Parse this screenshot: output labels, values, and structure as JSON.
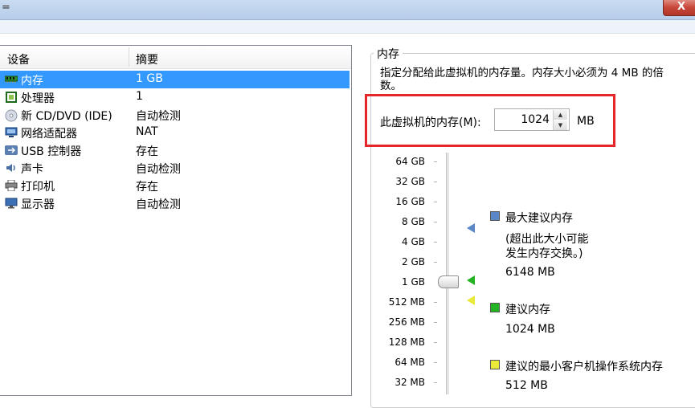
{
  "window": {
    "title_glyph": "=",
    "close_label": "X"
  },
  "device_table": {
    "headers": {
      "device": "设备",
      "summary": "摘要"
    },
    "rows": [
      {
        "name": "内存",
        "summary": "1 GB",
        "icon": "memory-icon",
        "selected": true
      },
      {
        "name": "处理器",
        "summary": "1",
        "icon": "processor-icon",
        "selected": false
      },
      {
        "name": "新 CD/DVD (IDE)",
        "summary": "自动检测",
        "icon": "cd-dvd-icon",
        "selected": false
      },
      {
        "name": "网络适配器",
        "summary": "NAT",
        "icon": "network-adapter-icon",
        "selected": false
      },
      {
        "name": "USB 控制器",
        "summary": "存在",
        "icon": "usb-icon",
        "selected": false
      },
      {
        "name": "声卡",
        "summary": "自动检测",
        "icon": "sound-card-icon",
        "selected": false
      },
      {
        "name": "打印机",
        "summary": "存在",
        "icon": "printer-icon",
        "selected": false
      },
      {
        "name": "显示器",
        "summary": "自动检测",
        "icon": "monitor-icon",
        "selected": false
      }
    ]
  },
  "memory": {
    "group_title": "内存",
    "description": "指定分配给此虚拟机的内存量。内存大小必须为 4 MB 的倍数。",
    "input_label": "此虚拟机的内存(M):",
    "value": "1024",
    "unit": "MB",
    "spin_up": "▲",
    "spin_down": "▼"
  },
  "scale": {
    "ticks": [
      "64 GB",
      "32 GB",
      "16 GB",
      "8 GB",
      "4 GB",
      "2 GB",
      "1 GB",
      "512 MB",
      "256 MB",
      "128 MB",
      "64 MB",
      "32 MB"
    ],
    "current": "1 GB"
  },
  "legend": {
    "max": {
      "title": "最大建议内存",
      "note_line1": "(超出此大小可能",
      "note_line2": "发生内存交换。)",
      "value": "6148 MB",
      "color": "#5b87c7"
    },
    "recommended": {
      "title": "建议内存",
      "value": "1024 MB",
      "color": "#22b422"
    },
    "min_guest": {
      "title": "建议的最小客户机操作系统内存",
      "value": "512 MB",
      "color": "#e9e93a"
    }
  },
  "colors": {
    "selection": "#3399ff",
    "highlight": "#e5262b"
  }
}
